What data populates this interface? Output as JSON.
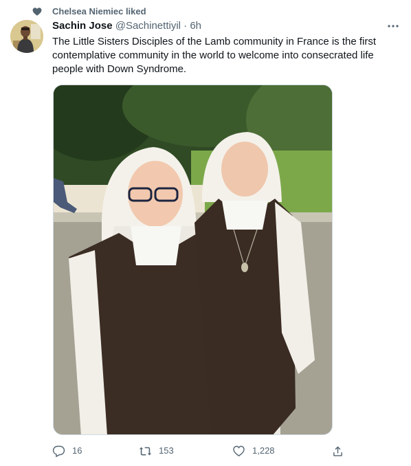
{
  "social_context": {
    "text": "Chelsea Niemiec liked",
    "icon": "heart-icon"
  },
  "author": {
    "name": "Sachin Jose",
    "handle": "@Sachinettiyil",
    "separator": "·",
    "time": "6h"
  },
  "tweet": {
    "text": "The Little Sisters Disciples of the Lamb community in France is the first contemplative community in the world to welcome into consecrated life people with Down Syndrome."
  },
  "actions": {
    "replies": "16",
    "retweets": "153",
    "likes": "1,228"
  },
  "icons": {
    "reply": "reply-icon",
    "retweet": "retweet-icon",
    "like": "like-icon",
    "share": "share-icon",
    "more": "more-icon"
  },
  "colors": {
    "secondary_text": "#536471",
    "primary_text": "#0f1419"
  }
}
